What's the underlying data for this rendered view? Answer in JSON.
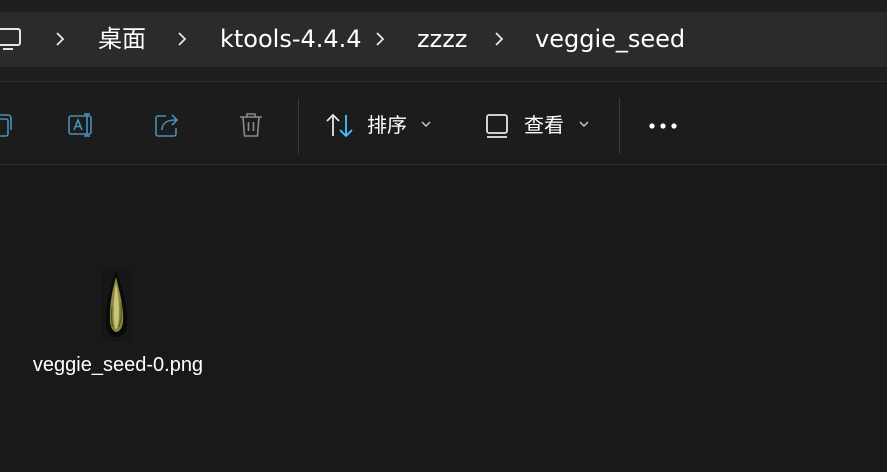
{
  "breadcrumb": {
    "root_icon": "computer-icon",
    "items": [
      "桌面",
      "ktools-4.4.4",
      "zzzz",
      "veggie_seed"
    ]
  },
  "toolbar": {
    "sort_label": "排序",
    "view_label": "查看",
    "icons": [
      "copy-icon",
      "rename-icon",
      "share-icon",
      "delete-icon",
      "sort-icon",
      "view-icon",
      "more-icon"
    ]
  },
  "files": [
    {
      "name": "veggie_seed-0.png",
      "thumbnail": "seed-image"
    }
  ],
  "colors": {
    "background": "#191919",
    "address_bar": "#2b2b2b",
    "accent_blue": "#4cc2ff",
    "text": "#ffffff"
  }
}
